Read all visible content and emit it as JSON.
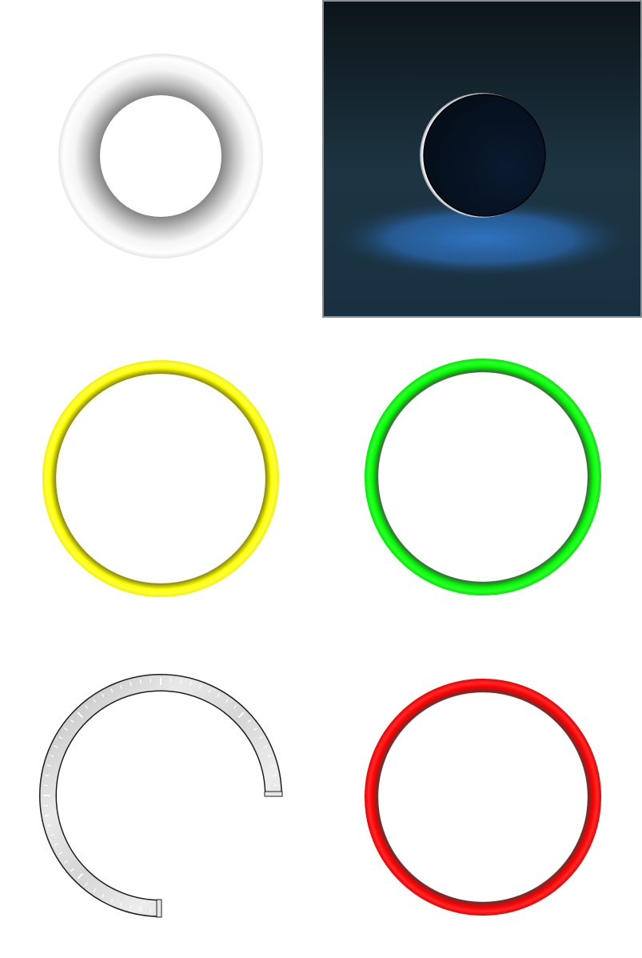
{
  "tiles": {
    "gray_torus": {
      "kind": "torus",
      "colors": [
        "#7f7f7f",
        "#f4f4f4",
        "#fefefe"
      ]
    },
    "dark_orb": {
      "kind": "moon-orb",
      "colors": {
        "bg_top": "#0c1418",
        "bg_bottom": "#1d3543",
        "glow": "#2f73c0",
        "orb": "#081526",
        "rim": "#ffffff"
      }
    },
    "yellow_ring": {
      "kind": "ring",
      "color": "#ffff00",
      "shade": "#8c8c12"
    },
    "green_ring": {
      "kind": "ring",
      "color": "#00ff00",
      "shade": "#2f6f2f"
    },
    "tick_gauge": {
      "kind": "ticked-arc",
      "colors": {
        "fill": "#cfcfcf",
        "edge": "#1e1e1e",
        "tick": "#ffffff",
        "shine": "#a9c6e6"
      }
    },
    "red_ring": {
      "kind": "ring",
      "color": "#ff0000",
      "shade": "#6e2a2a"
    }
  }
}
